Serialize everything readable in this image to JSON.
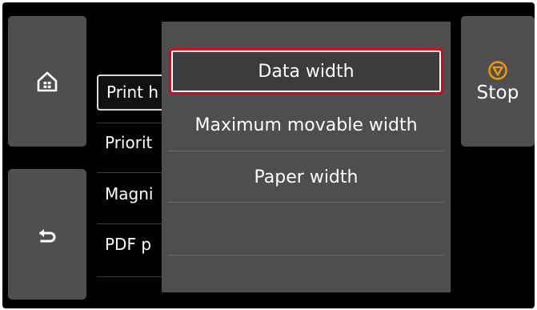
{
  "screen": {
    "left_buttons": {
      "home_icon": "home-icon",
      "back_icon": "back-arrow-icon"
    },
    "stop_button": {
      "icon": "stop-icon",
      "label": "Stop"
    },
    "background_menu": {
      "items": [
        {
          "label": "Print h",
          "selected": true
        },
        {
          "label": "Priorit",
          "selected": false
        },
        {
          "label": "Magni",
          "selected": false
        },
        {
          "label": "PDF p",
          "selected": false
        }
      ]
    },
    "popup_menu": {
      "options": [
        {
          "label": "Data width",
          "highlighted": true
        },
        {
          "label": "Maximum movable width",
          "highlighted": false
        },
        {
          "label": "Paper width",
          "highlighted": false
        }
      ]
    },
    "colors": {
      "panel_background": "#000000",
      "button_gray": "#4f4f4f",
      "popup_gray": "#4e4e4e",
      "highlight_border": "#e60012",
      "stop_icon_orange": "#f39800"
    }
  }
}
